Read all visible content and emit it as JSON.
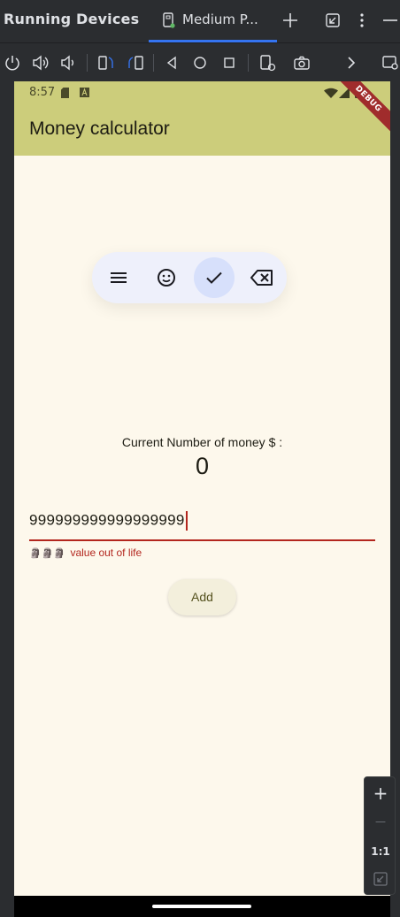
{
  "ide": {
    "title": "Running Devices",
    "tab_label": "Medium P...",
    "icons": [
      "add-tab-icon",
      "restore-window-icon",
      "more-options-icon",
      "minimize-icon"
    ],
    "toolbar_icons": [
      "power-icon",
      "volume-up-icon",
      "volume-down-icon",
      "rotate-left-icon",
      "rotate-right-icon",
      "back-icon",
      "home-icon",
      "overview-icon",
      "snapshot-icon",
      "camera-icon",
      "chevron-right-icon",
      "window-capture-icon"
    ],
    "zoom": {
      "zoom_in": "+",
      "zoom_out": "—",
      "actual_size": "1:1"
    }
  },
  "device": {
    "status_time": "8:57",
    "debug_banner": "DEBUG",
    "app_title": "Money calculator",
    "floating_toolbar": [
      "menu-icon",
      "emoji-icon",
      "check-icon",
      "backspace-icon"
    ],
    "money_label": "Current Number of money $ :",
    "money_value": "0",
    "input_value": "999999999999999999",
    "input_error": "value out of life",
    "error_emoji": "🗿🗿🗿",
    "add_button": "Add"
  },
  "colors": {
    "appbar": "#cccd7b",
    "background": "#fdf8ec",
    "error": "#b3261e",
    "accent_tab": "#3574f0"
  }
}
